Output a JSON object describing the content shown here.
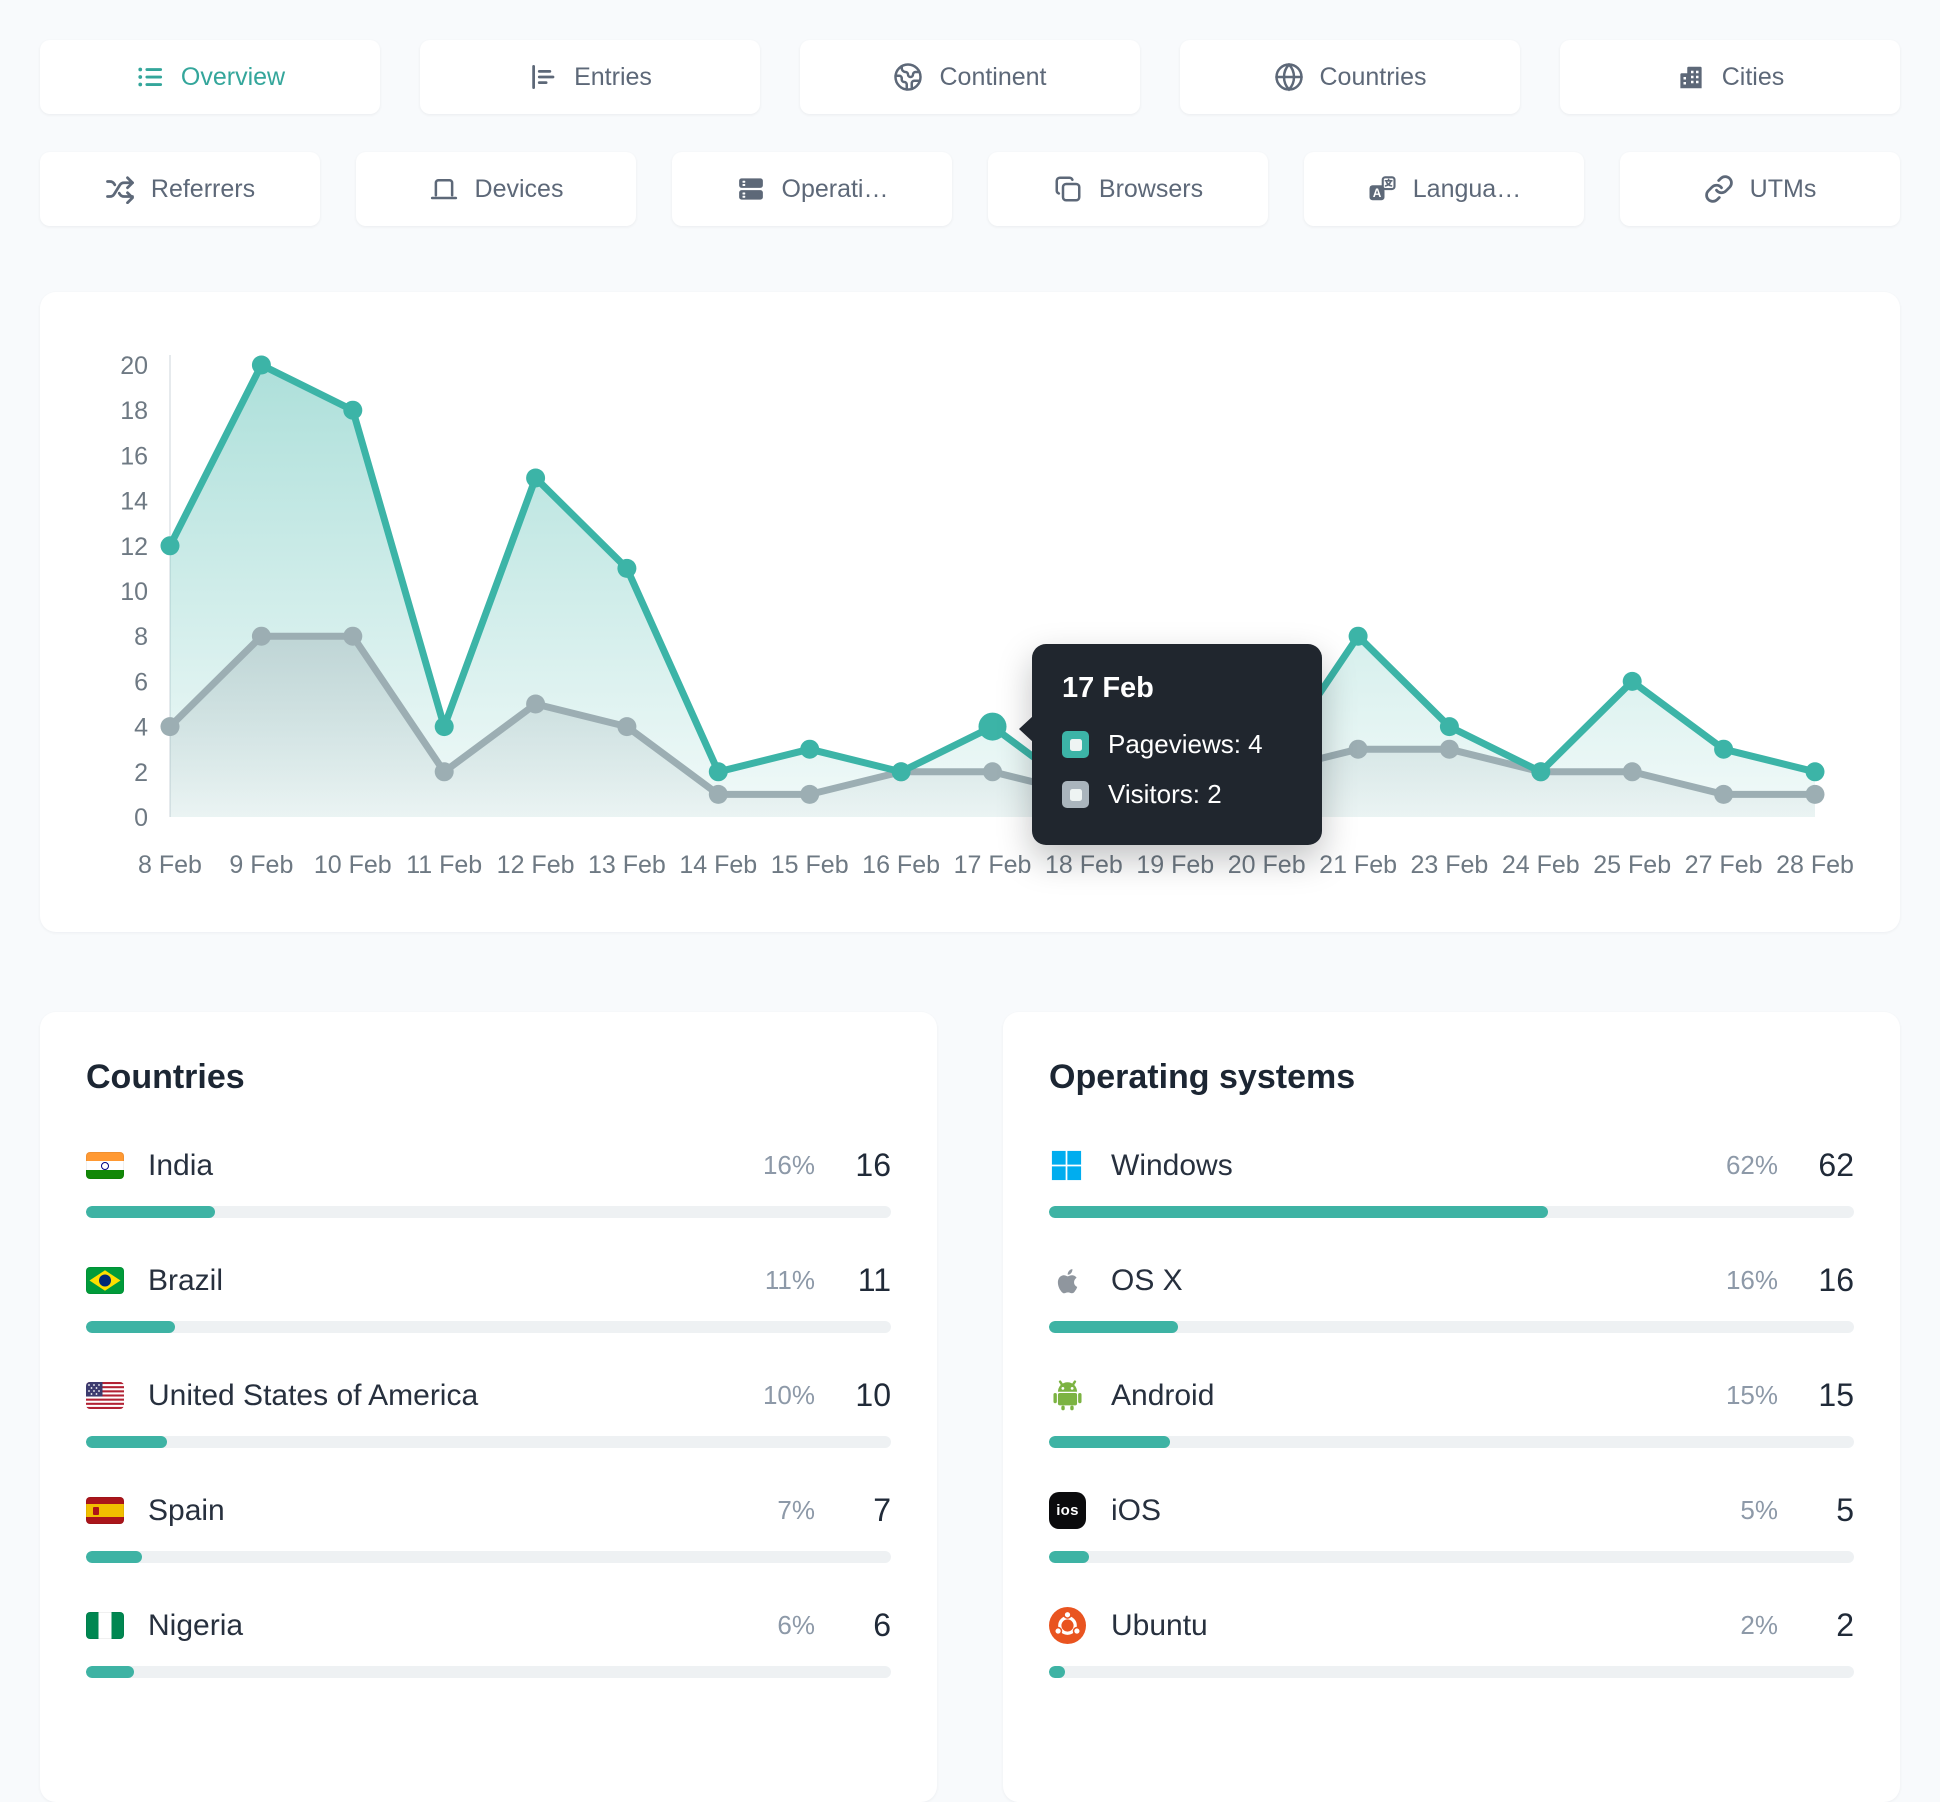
{
  "tabs_row1": [
    {
      "id": "overview",
      "label": "Overview",
      "active": true
    },
    {
      "id": "entries",
      "label": "Entries",
      "active": false
    },
    {
      "id": "continent",
      "label": "Continent",
      "active": false
    },
    {
      "id": "countries",
      "label": "Countries",
      "active": false
    },
    {
      "id": "cities",
      "label": "Cities",
      "active": false
    }
  ],
  "tabs_row2": [
    {
      "id": "referrers",
      "label": "Referrers",
      "active": false
    },
    {
      "id": "devices",
      "label": "Devices",
      "active": false
    },
    {
      "id": "operating-systems",
      "label": "Operati…",
      "active": false
    },
    {
      "id": "browsers",
      "label": "Browsers",
      "active": false
    },
    {
      "id": "languages",
      "label": "Langua…",
      "active": false
    },
    {
      "id": "utms",
      "label": "UTMs",
      "active": false
    }
  ],
  "chart_data": {
    "type": "line",
    "x": [
      "8 Feb",
      "9 Feb",
      "10 Feb",
      "11 Feb",
      "12 Feb",
      "13 Feb",
      "14 Feb",
      "15 Feb",
      "16 Feb",
      "17 Feb",
      "18 Feb",
      "19 Feb",
      "20 Feb",
      "21 Feb",
      "23 Feb",
      "24 Feb",
      "25 Feb",
      "27 Feb",
      "28 Feb"
    ],
    "series": [
      {
        "name": "Pageviews",
        "color": "#3cb4a7",
        "values": [
          12,
          20,
          18,
          4,
          15,
          11,
          2,
          3,
          2,
          4,
          1,
          1,
          2,
          8,
          4,
          2,
          6,
          3,
          2
        ]
      },
      {
        "name": "Visitors",
        "color": "#9caeb3",
        "values": [
          4,
          8,
          8,
          2,
          5,
          4,
          1,
          1,
          2,
          2,
          1,
          1,
          2,
          3,
          3,
          2,
          2,
          1,
          1
        ]
      }
    ],
    "ylim": [
      0,
      20
    ],
    "yticks": [
      0,
      2,
      4,
      6,
      8,
      10,
      12,
      14,
      16,
      18,
      20
    ],
    "grid": false,
    "legend_position": "none",
    "highlight": {
      "series": 0,
      "index": 9
    }
  },
  "tooltip": {
    "title": "17 Feb",
    "rows": [
      {
        "label": "Pageviews",
        "value": 4,
        "swatch_color": "#3cb4a7"
      },
      {
        "label": "Visitors",
        "value": 2,
        "swatch_color": "#aab5bd"
      }
    ]
  },
  "panels": [
    {
      "title": "Countries",
      "rows": [
        {
          "name": "India",
          "icon": "india-flag",
          "pct": 16,
          "pct_label": "16%",
          "value": 16
        },
        {
          "name": "Brazil",
          "icon": "brazil-flag",
          "pct": 11,
          "pct_label": "11%",
          "value": 11
        },
        {
          "name": "United States of America",
          "icon": "usa-flag",
          "pct": 10,
          "pct_label": "10%",
          "value": 10
        },
        {
          "name": "Spain",
          "icon": "spain-flag",
          "pct": 7,
          "pct_label": "7%",
          "value": 7
        },
        {
          "name": "Nigeria",
          "icon": "nigeria-flag",
          "pct": 6,
          "pct_label": "6%",
          "value": 6
        }
      ]
    },
    {
      "title": "Operating systems",
      "rows": [
        {
          "name": "Windows",
          "icon": "windows-logo",
          "pct": 62,
          "pct_label": "62%",
          "value": 62
        },
        {
          "name": "OS X",
          "icon": "apple-logo",
          "pct": 16,
          "pct_label": "16%",
          "value": 16
        },
        {
          "name": "Android",
          "icon": "android-logo",
          "pct": 15,
          "pct_label": "15%",
          "value": 15
        },
        {
          "name": "iOS",
          "icon": "ios-logo",
          "pct": 5,
          "pct_label": "5%",
          "value": 5
        },
        {
          "name": "Ubuntu",
          "icon": "ubuntu-logo",
          "pct": 2,
          "pct_label": "2%",
          "value": 2
        }
      ]
    }
  ],
  "colors": {
    "page_bg": "#f8fafc",
    "accent_teal": "#3cb4a7",
    "series_gray": "#9caeb3",
    "bar_fill": "#3eb3a4",
    "bar_track": "#eef1f3",
    "tooltip_bg": "#20262e",
    "tab_active_text": "#34a69b",
    "tab_text": "#5d6878",
    "axis_text": "#6e7983",
    "heading_text": "#1c2633"
  }
}
